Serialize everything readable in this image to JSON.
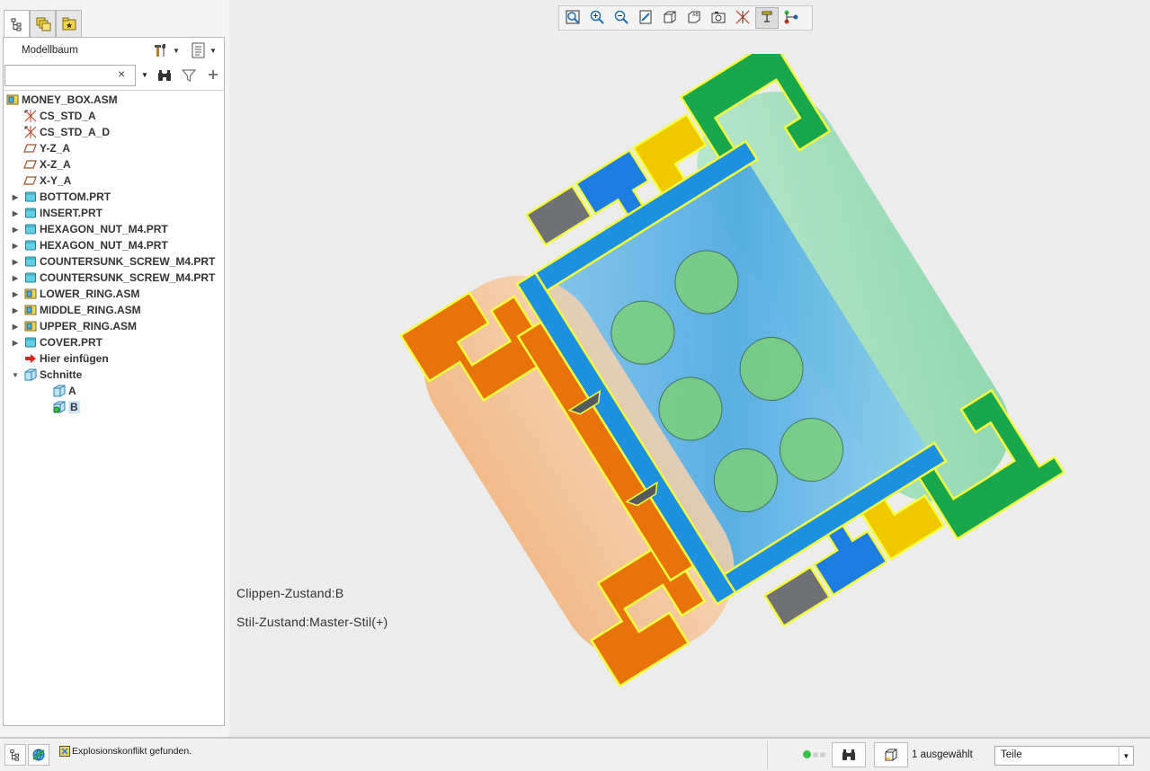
{
  "panel_tabs": [
    {
      "name": "model-tree-tab-icon",
      "active": true
    },
    {
      "name": "layers-tab-icon",
      "active": false
    },
    {
      "name": "favorites-tab-icon",
      "active": false
    }
  ],
  "tree": {
    "title": "Modellbaum",
    "search_value": "",
    "items": [
      {
        "label": "MONEY_BOX.ASM",
        "icon": "assembly-icon",
        "expandable": false,
        "expanded": false,
        "indent": 0,
        "selected": false
      },
      {
        "label": "CS_STD_A",
        "icon": "coordinate-system-icon",
        "expandable": false,
        "expanded": false,
        "indent": 1,
        "selected": false
      },
      {
        "label": "CS_STD_A_D",
        "icon": "coordinate-system-icon",
        "expandable": false,
        "expanded": false,
        "indent": 1,
        "selected": false
      },
      {
        "label": "Y-Z_A",
        "icon": "datum-plane-icon",
        "expandable": false,
        "expanded": false,
        "indent": 1,
        "selected": false
      },
      {
        "label": "X-Z_A",
        "icon": "datum-plane-icon",
        "expandable": false,
        "expanded": false,
        "indent": 1,
        "selected": false
      },
      {
        "label": "X-Y_A",
        "icon": "datum-plane-icon",
        "expandable": false,
        "expanded": false,
        "indent": 1,
        "selected": false
      },
      {
        "label": "BOTTOM.PRT",
        "icon": "part-icon",
        "expandable": true,
        "expanded": false,
        "indent": 1,
        "selected": false
      },
      {
        "label": "INSERT.PRT",
        "icon": "part-icon",
        "expandable": true,
        "expanded": false,
        "indent": 1,
        "selected": false
      },
      {
        "label": "HEXAGON_NUT_M4.PRT",
        "icon": "part-icon",
        "expandable": true,
        "expanded": false,
        "indent": 1,
        "selected": false
      },
      {
        "label": "HEXAGON_NUT_M4.PRT",
        "icon": "part-icon",
        "expandable": true,
        "expanded": false,
        "indent": 1,
        "selected": false
      },
      {
        "label": "COUNTERSUNK_SCREW_M4.PRT",
        "icon": "part-icon",
        "expandable": true,
        "expanded": false,
        "indent": 1,
        "selected": false
      },
      {
        "label": "COUNTERSUNK_SCREW_M4.PRT",
        "icon": "part-icon",
        "expandable": true,
        "expanded": false,
        "indent": 1,
        "selected": false
      },
      {
        "label": "LOWER_RING.ASM",
        "icon": "assembly-icon",
        "expandable": true,
        "expanded": false,
        "indent": 1,
        "selected": false
      },
      {
        "label": "MIDDLE_RING.ASM",
        "icon": "assembly-icon",
        "expandable": true,
        "expanded": false,
        "indent": 1,
        "selected": false
      },
      {
        "label": "UPPER_RING.ASM",
        "icon": "assembly-icon",
        "expandable": true,
        "expanded": false,
        "indent": 1,
        "selected": false
      },
      {
        "label": "COVER.PRT",
        "icon": "part-icon",
        "expandable": true,
        "expanded": false,
        "indent": 1,
        "selected": false
      },
      {
        "label": "Hier einfügen",
        "icon": "insert-here-arrow-icon",
        "expandable": false,
        "expanded": false,
        "indent": 1,
        "selected": false
      },
      {
        "label": "Schnitte",
        "icon": "sections-folder-icon",
        "expandable": true,
        "expanded": true,
        "indent": 1,
        "selected": false
      },
      {
        "label": "A",
        "icon": "section-icon",
        "expandable": false,
        "expanded": false,
        "indent": 2,
        "selected": false
      },
      {
        "label": "B",
        "icon": "active-section-icon",
        "expandable": false,
        "expanded": false,
        "indent": 2,
        "selected": true
      }
    ]
  },
  "graphics_toolbar": [
    {
      "name": "refit-icon",
      "active": false
    },
    {
      "name": "zoom-in-icon",
      "active": false
    },
    {
      "name": "zoom-out-icon",
      "active": false
    },
    {
      "name": "repaint-icon",
      "active": false
    },
    {
      "name": "display-style-icon",
      "active": false
    },
    {
      "name": "saved-orientations-icon",
      "active": false
    },
    {
      "name": "view-manager-icon",
      "active": false
    },
    {
      "name": "datum-display-icon",
      "active": false
    },
    {
      "name": "annotation-display-icon",
      "active": true
    },
    {
      "name": "spin-center-icon",
      "active": false
    }
  ],
  "viewport": {
    "clip_state": "Clippen-Zustand:B",
    "style_state": "Stil-Zustand:Master-Stil(+)"
  },
  "status": {
    "message": "Explosionskonflikt gefunden.",
    "selected_count": "1 ausgewählt",
    "filter_value": "Teile"
  },
  "colors": {
    "orange": "#e8720c",
    "blue": "#1e90e0",
    "green": "#1aa64c",
    "yellow": "#f0c800",
    "gray": "#6f7175",
    "section_edge": "#f5ff3c",
    "tree_selection": "#cde6fb"
  }
}
